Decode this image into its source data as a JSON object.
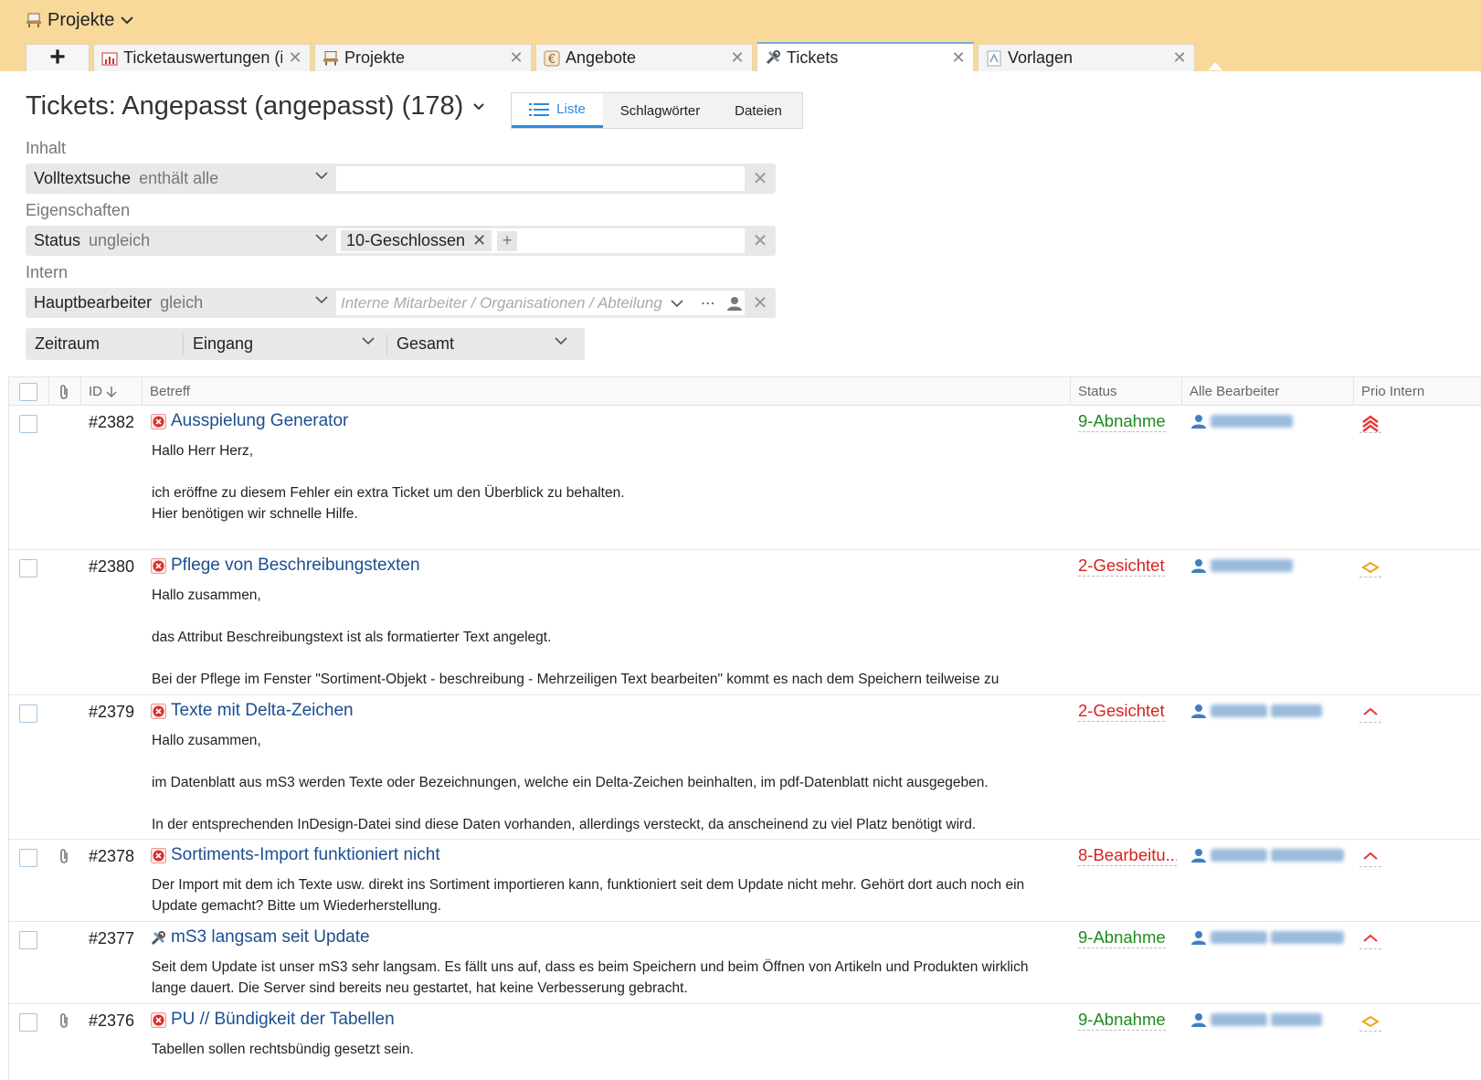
{
  "header": {
    "project_label": "Projekte"
  },
  "tabs": [
    {
      "label": "Ticketauswertungen (int",
      "icon": "chart-icon"
    },
    {
      "label": "Projekte",
      "icon": "project-icon"
    },
    {
      "label": "Angebote",
      "icon": "euro-icon"
    },
    {
      "label": "Tickets",
      "icon": "tools-icon",
      "active": true
    },
    {
      "label": "Vorlagen",
      "icon": "template-icon"
    }
  ],
  "add_tab_label": "+",
  "page": {
    "title": "Tickets: Angepasst (angepasst) (178)"
  },
  "views": {
    "liste": "Liste",
    "schlagwoerter": "Schlagwörter",
    "dateien": "Dateien"
  },
  "filters": {
    "inhalt": {
      "section": "Inhalt",
      "field": "Volltextsuche",
      "op": "enthält alle",
      "value": ""
    },
    "eigenschaften": {
      "section": "Eigenschaften",
      "field": "Status",
      "op": "ungleich",
      "chip": "10-Geschlossen"
    },
    "intern": {
      "section": "Intern",
      "field": "Hauptbearbeiter",
      "op": "gleich",
      "placeholder": "Interne Mitarbeiter / Organisationen / Abteilung"
    },
    "zeitraum": {
      "label": "Zeitraum",
      "type": "Eingang",
      "range": "Gesamt"
    }
  },
  "table": {
    "headers": {
      "id": "ID",
      "betreff": "Betreff",
      "status": "Status",
      "bearbeiter": "Alle Bearbeiter",
      "prio": "Prio Intern"
    },
    "rows": [
      {
        "id": "#2382",
        "title": "Ausspielung Generator",
        "type_icon": "error-icon",
        "attachment": false,
        "body": [
          "Hallo Herr Herz,",
          "",
          "ich eröffne zu diesem Fehler ein extra Ticket um den Überblick zu behalten.",
          "Hier benötigen wir schnelle Hilfe."
        ],
        "status": "9-Abnahme",
        "status_color": "#1d8b1d",
        "prio_icon": "prio-highest-icon"
      },
      {
        "id": "#2380",
        "title": "Pflege von Beschreibungstexten",
        "type_icon": "error-icon",
        "attachment": false,
        "body": [
          "Hallo zusammen,",
          "",
          "das Attribut Beschreibungstext ist als formatierter Text angelegt.",
          "",
          "Bei der Pflege im Fenster \"Sortiment-Objekt - beschreibung - Mehrzeiligen Text bearbeiten\" kommt es nach dem Speichern teilweise zu"
        ],
        "status": "2-Gesichtet",
        "status_color": "#d8221f",
        "prio_icon": "prio-medium-icon"
      },
      {
        "id": "#2379",
        "title": "Texte mit Delta-Zeichen",
        "type_icon": "error-icon",
        "attachment": false,
        "body": [
          "Hallo zusammen,",
          "",
          "im Datenblatt aus mS3 werden Texte oder Bezeichnungen, welche ein Delta-Zeichen beinhalten, im pdf-Datenblatt nicht ausgegeben.",
          "",
          "In der entsprechenden InDesign-Datei sind diese Daten vorhanden, allerdings versteckt, da anscheinend zu viel Platz benötigt wird."
        ],
        "status": "2-Gesichtet",
        "status_color": "#d8221f",
        "prio_icon": "prio-high-icon"
      },
      {
        "id": "#2378",
        "title": "Sortiments-Import funktioniert nicht",
        "type_icon": "error-icon",
        "attachment": true,
        "body": [
          "Der Import mit dem ich Texte usw. direkt ins Sortiment importieren kann, funktioniert seit dem Update nicht mehr.  Gehört dort auch noch ein Update gemacht? Bitte um Wiederherstellung."
        ],
        "status": "8-Bearbeitu...",
        "status_color": "#d8221f",
        "prio_icon": "prio-high-icon"
      },
      {
        "id": "#2377",
        "title": "mS3 langsam seit Update",
        "type_icon": "tools-icon",
        "attachment": false,
        "body": [
          "Seit dem Update ist unser mS3 sehr langsam. Es fällt uns auf, dass es beim Speichern und beim Öffnen von Artikeln und Produkten wirklich lange dauert. Die Server sind bereits neu gestartet, hat keine Verbesserung gebracht."
        ],
        "status": "9-Abnahme",
        "status_color": "#1d8b1d",
        "prio_icon": "prio-high-icon"
      },
      {
        "id": "#2376",
        "title": "PU // Bündigkeit der Tabellen",
        "type_icon": "error-icon",
        "attachment": true,
        "body": [
          "Tabellen sollen rechtsbündig gesetzt sein."
        ],
        "status": "9-Abnahme",
        "status_color": "#1d8b1d",
        "prio_icon": "prio-medium-icon"
      }
    ]
  }
}
